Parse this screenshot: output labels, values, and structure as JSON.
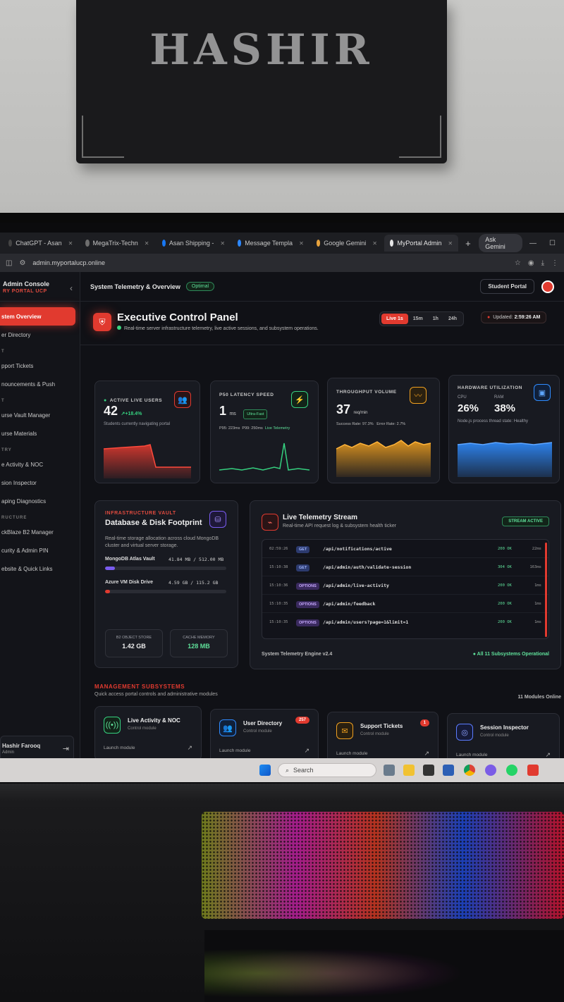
{
  "wall": {
    "name": "HASHIR"
  },
  "browser": {
    "tabs": [
      {
        "label": "ChatGPT - Asan",
        "color": "#444444"
      },
      {
        "label": "MegaTrix-Techn",
        "color": "#6e6e6e"
      },
      {
        "label": "Asan Shipping -",
        "color": "#1877f2"
      },
      {
        "label": "Message Templa",
        "color": "#2d88ff"
      },
      {
        "label": "Google Gemini",
        "color": "#e8a33d"
      },
      {
        "label": "MyPortal Admin",
        "color": "#e6e6e6"
      }
    ],
    "ask_gemini": "Ask Gemini",
    "url": "admin.myportalucp.online"
  },
  "sidebar": {
    "title": "Admin Console",
    "subtitle": "RY PORTAL UCP",
    "items": [
      {
        "label": "stem Overview",
        "active": true
      },
      {
        "label": "er Directory"
      },
      {
        "section": "T"
      },
      {
        "label": "pport Tickets"
      },
      {
        "label": "nouncements & Push"
      },
      {
        "section": "T"
      },
      {
        "label": "urse Vault Manager"
      },
      {
        "label": "urse Materials"
      },
      {
        "section": "TRY"
      },
      {
        "label": "e Activity & NOC"
      },
      {
        "label": "sion Inspector"
      },
      {
        "label": "aping Diagnostics"
      },
      {
        "section": "RUCTURE"
      },
      {
        "label": "ckBlaze B2 Manager"
      },
      {
        "label": "curity & Admin PIN"
      },
      {
        "label": "ebsite & Quick Links"
      }
    ],
    "user_name": "Hashir Farooq",
    "user_role": "Admin"
  },
  "topbar": {
    "title": "System Telemetry & Overview",
    "badge": "Optimal",
    "student_portal": "Student Portal"
  },
  "hero": {
    "title": "Executive Control Panel",
    "subtitle": "Real-time server infrastructure telemetry, live active sessions, and subsystem operations.",
    "ranges": [
      "Live 1s",
      "15m",
      "1h",
      "24h"
    ],
    "updated_label": "Updated:",
    "updated_time": "2:59:26 AM"
  },
  "stats": {
    "users": {
      "caption": "ACTIVE LIVE USERS",
      "value": "42",
      "delta": "+18.4%",
      "note": "Students currently navigating portal",
      "color": "#e13a2f"
    },
    "latency": {
      "caption": "P50 LATENCY SPEED",
      "value": "1",
      "unit": "ms",
      "tag": "Ultra-Fast",
      "p95": "P95: 223ms",
      "p99": "P99: 250ms",
      "live": "Live Telemetry",
      "color": "#35d07f"
    },
    "throughput": {
      "caption": "THROUGHPUT VOLUME",
      "value": "37",
      "unit": "req/min",
      "success": "Success Rate: 97.3%",
      "error": "Error Rate: 2.7%",
      "color": "#f0a020"
    },
    "hardware": {
      "caption": "HARDWARE UTILIZATION",
      "cpu_label": "CPU",
      "ram_label": "RAM",
      "cpu": "26%",
      "ram": "38%",
      "note": "Node.js process thread state: Healthy",
      "color": "#2f8cff"
    }
  },
  "vault": {
    "kicker": "INFRASTRUCTURE VAULT",
    "title": "Database & Disk Footprint",
    "desc": "Real-time storage allocation across cloud MongoDB cluster and virtual server storage.",
    "rows": [
      {
        "label": "MongoDB Atlas Vault",
        "value": "41.84 MB / 512.00 MB",
        "fill": 0.08,
        "color": "#7a5cf0"
      },
      {
        "label": "Azure VM Disk Drive",
        "value": "4.59 GB / 115.2 GB",
        "fill": 0.04,
        "color": "#e13a2f"
      }
    ],
    "b2_label": "B2 OBJECT STORE",
    "b2_value": "1.42 GB",
    "cache_label": "CACHE MEMORY",
    "cache_value": "128 MB"
  },
  "telemetry": {
    "title": "Live Telemetry Stream",
    "subtitle": "Real-time API request log & subsystem health ticker",
    "badge": "STREAM ACTIVE",
    "rows": [
      {
        "ts": "02:59:26",
        "method": "GET",
        "path": "/api/notifications/active",
        "status": "200 OK",
        "dur": "22ms"
      },
      {
        "ts": "15:10:38",
        "method": "GET",
        "path": "/api/admin/auth/validate-session",
        "status": "304 OK",
        "dur": "163ms"
      },
      {
        "ts": "15:10:36",
        "method": "OPTIONS",
        "path": "/api/admin/live-activity",
        "status": "200 OK",
        "dur": "1ms"
      },
      {
        "ts": "15:10:35",
        "method": "OPTIONS",
        "path": "/api/admin/feedback",
        "status": "200 OK",
        "dur": "1ms"
      },
      {
        "ts": "15:10:35",
        "method": "OPTIONS",
        "path": "/api/admin/users?page=1&limit=1",
        "status": "200 OK",
        "dur": "1ms"
      }
    ],
    "engine": "System Telemetry Engine v2.4",
    "health": "All 11 Subsystems Operational"
  },
  "subsystems": {
    "kicker": "MANAGEMENT SUBSYSTEMS",
    "subtitle": "Quick access portal controls and administrative modules",
    "online": "11 Modules Online",
    "modules": [
      {
        "title": "Live Activity & NOC",
        "sub": "Control module",
        "launch": "Launch module",
        "color": "#35d07f",
        "count": ""
      },
      {
        "title": "User Directory",
        "sub": "Control module",
        "launch": "Launch module",
        "color": "#2f8cff",
        "count": "257"
      },
      {
        "title": "Support Tickets",
        "sub": "Control module",
        "launch": "Launch module",
        "color": "#f0a020",
        "count": "1"
      },
      {
        "title": "Session Inspector",
        "sub": "Control module",
        "launch": "Launch module",
        "color": "#5b7cff",
        "count": ""
      }
    ]
  },
  "taskbar": {
    "search": "Search"
  }
}
